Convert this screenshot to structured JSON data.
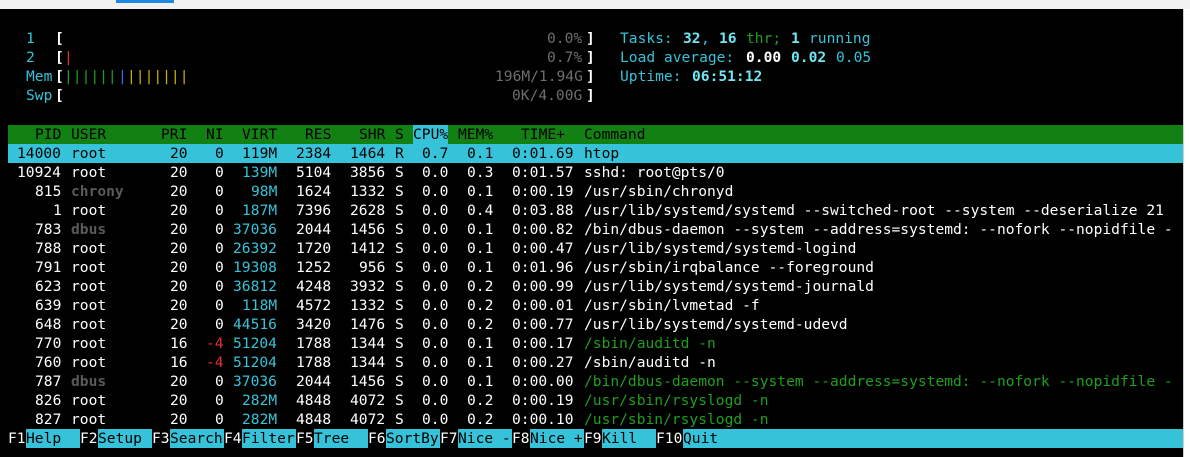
{
  "window": {
    "title": ""
  },
  "meters": {
    "cpu1": {
      "label": "1",
      "bar": "",
      "value": "0.0%"
    },
    "cpu2": {
      "label": "2",
      "bar": "|",
      "value": "0.7%"
    },
    "mem": {
      "label": "Mem",
      "bar_green": "||||||",
      "bar_blue": "|",
      "bar_yellow": "|||||||",
      "value": "196M/1.94G"
    },
    "swp": {
      "label": "Swp",
      "bar": "",
      "value": "0K/4.00G"
    }
  },
  "summary": {
    "tasks_label": "Tasks:",
    "tasks_count": "32",
    "threads": "16",
    "thr_label": "thr;",
    "running": "1",
    "running_label": "running",
    "load_label": "Load average:",
    "load1": "0.00",
    "load5": "0.02",
    "load15": "0.05",
    "uptime_label": "Uptime:",
    "uptime": "06:51:12"
  },
  "columns": [
    "PID",
    "USER",
    "PRI",
    "NI",
    "VIRT",
    "RES",
    "SHR",
    "S",
    "CPU%",
    "MEM%",
    "TIME+",
    "Command"
  ],
  "sort_column": "CPU%",
  "processes": [
    {
      "pid": "14000",
      "user": "root",
      "pri": "20",
      "ni": "0",
      "virt": "119M",
      "res": "2384",
      "shr": "1464",
      "s": "R",
      "cpu": "0.7",
      "mem": "0.1",
      "time": "0:01.69",
      "cmd": "htop",
      "selected": true
    },
    {
      "pid": "10924",
      "user": "root",
      "pri": "20",
      "ni": "0",
      "virt": "139M",
      "res": "5104",
      "shr": "3856",
      "s": "S",
      "cpu": "0.0",
      "mem": "0.3",
      "time": "0:01.57",
      "cmd": "sshd: root@pts/0"
    },
    {
      "pid": "815",
      "user": "chrony",
      "pri": "20",
      "ni": "0",
      "virt": "98M",
      "res": "1624",
      "shr": "1332",
      "s": "S",
      "cpu": "0.0",
      "mem": "0.1",
      "time": "0:00.19",
      "cmd": "/usr/sbin/chronyd"
    },
    {
      "pid": "1",
      "user": "root",
      "pri": "20",
      "ni": "0",
      "virt": "187M",
      "res": "7396",
      "shr": "2628",
      "s": "S",
      "cpu": "0.0",
      "mem": "0.4",
      "time": "0:03.88",
      "cmd": "/usr/lib/systemd/systemd --switched-root --system --deserialize 21"
    },
    {
      "pid": "783",
      "user": "dbus",
      "pri": "20",
      "ni": "0",
      "virt": "37036",
      "res": "2044",
      "shr": "1456",
      "s": "S",
      "cpu": "0.0",
      "mem": "0.1",
      "time": "0:00.82",
      "cmd": "/bin/dbus-daemon --system --address=systemd: --nofork --nopidfile -"
    },
    {
      "pid": "788",
      "user": "root",
      "pri": "20",
      "ni": "0",
      "virt": "26392",
      "res": "1720",
      "shr": "1412",
      "s": "S",
      "cpu": "0.0",
      "mem": "0.1",
      "time": "0:00.47",
      "cmd": "/usr/lib/systemd/systemd-logind"
    },
    {
      "pid": "791",
      "user": "root",
      "pri": "20",
      "ni": "0",
      "virt": "19308",
      "res": "1252",
      "shr": "956",
      "s": "S",
      "cpu": "0.0",
      "mem": "0.1",
      "time": "0:01.96",
      "cmd": "/usr/sbin/irqbalance --foreground"
    },
    {
      "pid": "623",
      "user": "root",
      "pri": "20",
      "ni": "0",
      "virt": "36812",
      "res": "4248",
      "shr": "3932",
      "s": "S",
      "cpu": "0.0",
      "mem": "0.2",
      "time": "0:00.99",
      "cmd": "/usr/lib/systemd/systemd-journald"
    },
    {
      "pid": "639",
      "user": "root",
      "pri": "20",
      "ni": "0",
      "virt": "118M",
      "res": "4572",
      "shr": "1332",
      "s": "S",
      "cpu": "0.0",
      "mem": "0.2",
      "time": "0:00.01",
      "cmd": "/usr/sbin/lvmetad -f"
    },
    {
      "pid": "648",
      "user": "root",
      "pri": "20",
      "ni": "0",
      "virt": "44516",
      "res": "3420",
      "shr": "1476",
      "s": "S",
      "cpu": "0.0",
      "mem": "0.2",
      "time": "0:00.77",
      "cmd": "/usr/lib/systemd/systemd-udevd"
    },
    {
      "pid": "770",
      "user": "root",
      "pri": "16",
      "ni": "-4",
      "virt": "51204",
      "res": "1788",
      "shr": "1344",
      "s": "S",
      "cpu": "0.0",
      "mem": "0.1",
      "time": "0:00.17",
      "cmd": "/sbin/auditd -n",
      "thread": true
    },
    {
      "pid": "760",
      "user": "root",
      "pri": "16",
      "ni": "-4",
      "virt": "51204",
      "res": "1788",
      "shr": "1344",
      "s": "S",
      "cpu": "0.0",
      "mem": "0.1",
      "time": "0:00.27",
      "cmd": "/sbin/auditd -n"
    },
    {
      "pid": "787",
      "user": "dbus",
      "pri": "20",
      "ni": "0",
      "virt": "37036",
      "res": "2044",
      "shr": "1456",
      "s": "S",
      "cpu": "0.0",
      "mem": "0.1",
      "time": "0:00.00",
      "cmd": "/bin/dbus-daemon --system --address=systemd: --nofork --nopidfile -",
      "thread": true
    },
    {
      "pid": "826",
      "user": "root",
      "pri": "20",
      "ni": "0",
      "virt": "282M",
      "res": "4848",
      "shr": "4072",
      "s": "S",
      "cpu": "0.0",
      "mem": "0.2",
      "time": "0:00.19",
      "cmd": "/usr/sbin/rsyslogd -n",
      "thread": true
    },
    {
      "pid": "827",
      "user": "root",
      "pri": "20",
      "ni": "0",
      "virt": "282M",
      "res": "4848",
      "shr": "4072",
      "s": "S",
      "cpu": "0.0",
      "mem": "0.2",
      "time": "0:00.10",
      "cmd": "/usr/sbin/rsyslogd -n",
      "thread": true
    }
  ],
  "function_keys": [
    {
      "key": "F1",
      "label": "Help  "
    },
    {
      "key": "F2",
      "label": "Setup "
    },
    {
      "key": "F3",
      "label": "Search"
    },
    {
      "key": "F4",
      "label": "Filter"
    },
    {
      "key": "F5",
      "label": "Tree  "
    },
    {
      "key": "F6",
      "label": "SortBy"
    },
    {
      "key": "F7",
      "label": "Nice -"
    },
    {
      "key": "F8",
      "label": "Nice +"
    },
    {
      "key": "F9",
      "label": "Kill  "
    },
    {
      "key": "F10",
      "label": "Quit  "
    }
  ],
  "colors": {
    "background": "#000000",
    "header_bar": "#128012",
    "selection": "#36c3d9",
    "text_cyan": "#36c3d9",
    "thread_green": "#1f9f1f"
  }
}
